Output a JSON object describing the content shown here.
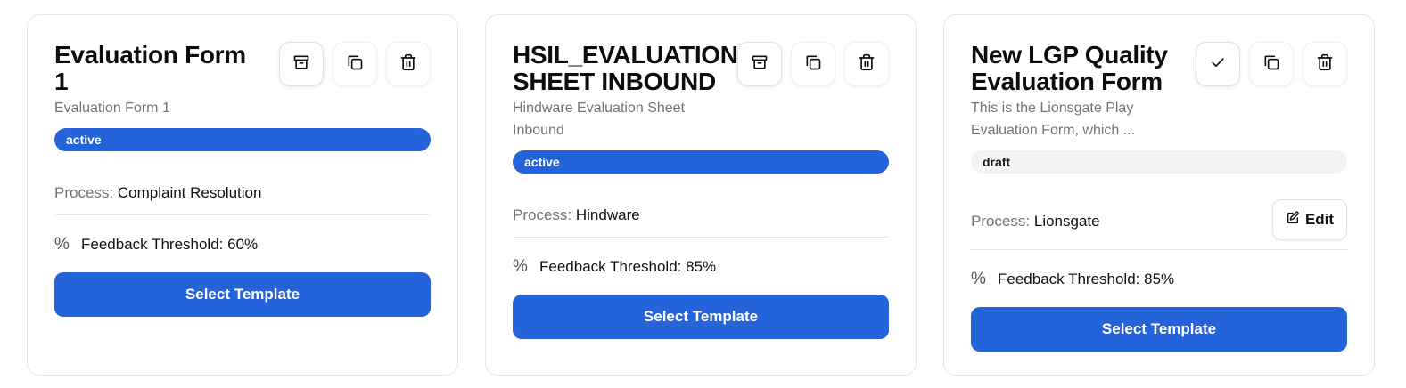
{
  "templates": [
    {
      "title": "Evaluation Form 1",
      "description": "Evaluation Form 1",
      "status": "active",
      "process_label": "Process:",
      "process_value": "Complaint Resolution",
      "threshold_icon": "%",
      "threshold_text": "Feedback Threshold: 60%",
      "select_label": "Select Template",
      "actions": [
        "archive-icon",
        "copy-icon",
        "trash-icon"
      ]
    },
    {
      "title": "HSIL_EVALUATION SHEET INBOUND",
      "description": "Hindware Evaluation Sheet Inbound",
      "status": "active",
      "process_label": "Process:",
      "process_value": "Hindware",
      "threshold_icon": "%",
      "threshold_text": "Feedback Threshold: 85%",
      "select_label": "Select Template",
      "actions": [
        "archive-icon",
        "copy-icon",
        "trash-icon"
      ]
    },
    {
      "title": "New LGP Quality Evaluation Form",
      "description": "This is the Lionsgate Play Evaluation Form, which ...",
      "status": "draft",
      "process_label": "Process:",
      "process_value": "Lionsgate",
      "edit_label": "Edit",
      "threshold_icon": "%",
      "threshold_text": "Feedback Threshold: 85%",
      "select_label": "Select Template",
      "actions": [
        "check-icon",
        "copy-icon",
        "trash-icon"
      ]
    }
  ],
  "colors": {
    "primary": "#2563da",
    "muted_text": "#737373",
    "draft_badge_bg": "#f3f3f3",
    "border": "#e6e6e6"
  }
}
